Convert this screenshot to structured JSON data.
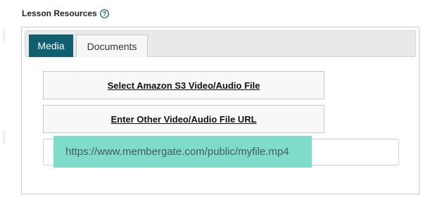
{
  "section": {
    "title": "Lesson Resources",
    "help_icon": "question-circle-icon"
  },
  "tabs": [
    {
      "label": "Media",
      "active": true
    },
    {
      "label": "Documents",
      "active": false
    }
  ],
  "buttons": {
    "select_s3": "Select Amazon S3 Video/Audio File",
    "enter_url": "Enter Other Video/Audio File URL"
  },
  "url_input": {
    "value": "",
    "placeholder": "https://www.membergate.com/public/myfile.mp4"
  },
  "colors": {
    "active_tab": "#0f5f6f",
    "highlight": "#7fdcca",
    "help_icon": "#0f5f6f"
  }
}
